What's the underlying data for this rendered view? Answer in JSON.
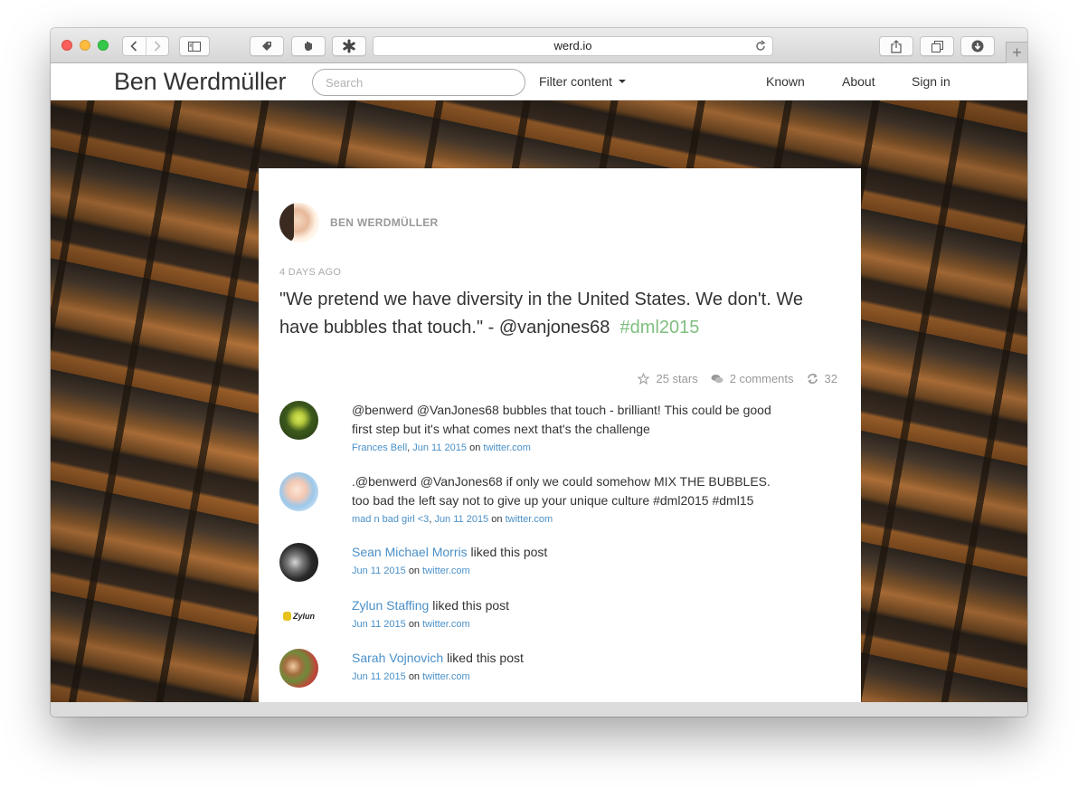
{
  "browser": {
    "url": "werd.io"
  },
  "site": {
    "brand": "Ben Werdmüller",
    "search_placeholder": "Search",
    "filter_label": "Filter content",
    "nav": [
      "Known",
      "About",
      "Sign in"
    ]
  },
  "post": {
    "author": "BEN WERDMÜLLER",
    "timestamp": "4 DAYS AGO",
    "body": "\"We pretend we have diversity in the United States. We don't. We have bubbles that touch.\" - @vanjones68",
    "hashtag": "#dml2015",
    "stats": {
      "stars": "25 stars",
      "comments": "2 comments",
      "reshares": "32"
    }
  },
  "responses": [
    {
      "text": "@benwerd @VanJones68 bubbles that touch - brilliant! This could be good first step but it's what comes next that's the challenge",
      "author": "Frances Bell",
      "date": "Jun 11 2015",
      "on": "on",
      "source": "twitter.com"
    },
    {
      "text": ".@benwerd @VanJones68 if only we could somehow MIX THE BUBBLES. too bad the left say not to give up your unique culture #dml2015 #dml15",
      "author": "mad n bad girl <3",
      "date": "Jun 11 2015",
      "on": "on",
      "source": "twitter.com"
    },
    {
      "author": "Sean Michael Morris",
      "action": "liked this post",
      "date": "Jun 11 2015",
      "on": "on",
      "source": "twitter.com"
    },
    {
      "author": "Zylun Staffing",
      "action": "liked this post",
      "date": "Jun 11 2015",
      "on": "on",
      "source": "twitter.com",
      "avatar_text": "Zylun"
    },
    {
      "author": "Sarah Vojnovich",
      "action": "liked this post",
      "date": "Jun 11 2015",
      "on": "on",
      "source": "twitter.com"
    }
  ],
  "colors": {
    "link": "#4a90c8",
    "hashtag": "#7fbf7f"
  }
}
